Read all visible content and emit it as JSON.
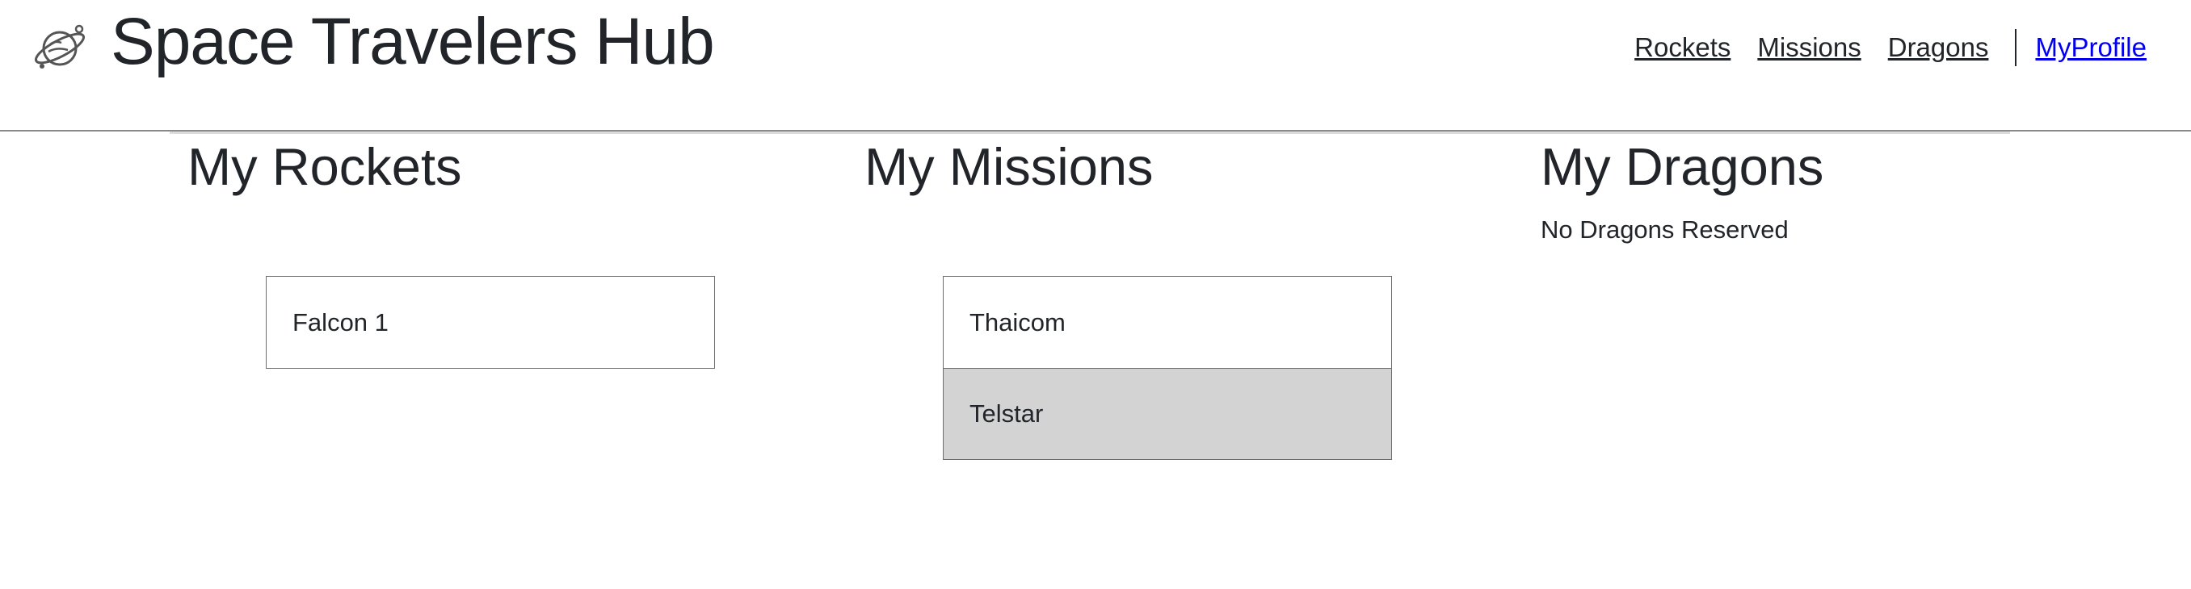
{
  "header": {
    "brand": "Space Travelers Hub",
    "nav": {
      "rockets": "Rockets",
      "missions": "Missions",
      "dragons": "Dragons",
      "profile": "MyProfile"
    }
  },
  "sections": {
    "rockets": {
      "title": "My Rockets",
      "items": [
        "Falcon 1"
      ]
    },
    "missions": {
      "title": "My Missions",
      "items": [
        "Thaicom",
        "Telstar"
      ]
    },
    "dragons": {
      "title": "My Dragons",
      "empty_message": "No Dragons Reserved"
    }
  },
  "colors": {
    "link_active": "#0000ee",
    "row_highlight": "#d3d3d3"
  },
  "icons": {
    "logo": "planet-icon"
  }
}
